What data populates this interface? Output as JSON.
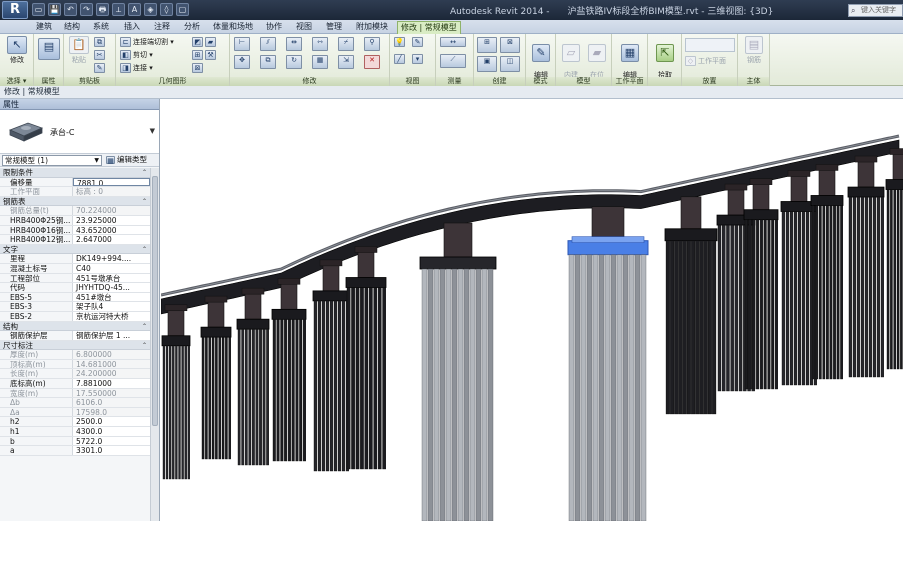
{
  "window": {
    "app_title": "Autodesk Revit 2014 -",
    "document_title": "沪盐铁路IV标段全桥BIM模型.rvt - 三维视图: {3D}",
    "search_placeholder": "键入关键字"
  },
  "app_button": {
    "label": "R"
  },
  "quick_access": [
    "open-icon",
    "save-icon",
    "undo-icon",
    "redo-icon",
    "print-icon",
    "measure-icon",
    "text-icon",
    "3d-view-icon",
    "section-icon",
    "close-hidden-icon"
  ],
  "quick_access_glyphs": [
    "▭",
    "💾",
    "↶",
    "↷",
    "🖶",
    "⟂",
    "A",
    "◈",
    "◊",
    "▢"
  ],
  "tabs": [
    {
      "label": "建筑"
    },
    {
      "label": "结构"
    },
    {
      "label": "系统"
    },
    {
      "label": "插入"
    },
    {
      "label": "注释"
    },
    {
      "label": "分析"
    },
    {
      "label": "体量和场地"
    },
    {
      "label": "协作"
    },
    {
      "label": "视图"
    },
    {
      "label": "管理"
    },
    {
      "label": "附加模块"
    },
    {
      "label": "修改 | 常规模型"
    }
  ],
  "ribbon": {
    "select": {
      "panel_label": "选择 ▾",
      "modify_label": "修改"
    },
    "properties": {
      "panel_label": "属性"
    },
    "clipboard": {
      "panel_label": "剪贴板",
      "paste_label": "粘贴"
    },
    "geometry": {
      "panel_label": "几何图形",
      "join_cut_label": "连接端切割 ▾",
      "cut_label": "剪切 ▾",
      "join_label": "连接 ▾"
    },
    "modify": {
      "panel_label": "修改"
    },
    "view": {
      "panel_label": "视图"
    },
    "measure": {
      "panel_label": "测量"
    },
    "create": {
      "panel_label": "创建"
    },
    "mode": {
      "panel_label": "模式",
      "edit_family_label": "编辑\n族"
    },
    "model": {
      "panel_label": "模型",
      "inplace_label": "内建\n模型",
      "massing_label": "在位\n体量"
    },
    "work_plane": {
      "panel_label": "工作平面",
      "edit_wp_label": "编辑\n工作平面",
      "pick_new_label": "拾取\n新的"
    },
    "place": {
      "panel_label": "放置",
      "wp_label": "工作平面"
    },
    "host": {
      "panel_label": "主体",
      "rebar_label": "钢筋"
    }
  },
  "options_bar": {
    "label": "修改 | 常规模型"
  },
  "properties": {
    "header": "属性",
    "type_name": "承台-C",
    "filter_label": "常规模型 (1)",
    "edit_type_label": "编辑类型",
    "groups": [
      {
        "name": "限制条件",
        "rows": [
          {
            "name": "偏移量",
            "value": "7881.0",
            "readonly": false,
            "selected": true
          },
          {
            "name": "工作平面",
            "value": "标高 : 0",
            "readonly": true
          }
        ]
      },
      {
        "name": "钢筋表",
        "rows": [
          {
            "name": "钢筋总量(t)",
            "value": "70.224000",
            "readonly": true
          },
          {
            "name": "HRB400Φ25钢...",
            "value": "23.925000",
            "readonly": false
          },
          {
            "name": "HRB400Φ16钢...",
            "value": "43.652000",
            "readonly": false
          },
          {
            "name": "HRB400Φ12钢...",
            "value": "2.647000",
            "readonly": false
          }
        ]
      },
      {
        "name": "文字",
        "rows": [
          {
            "name": "里程",
            "value": "DK149+994....",
            "readonly": false
          },
          {
            "name": "混凝土标号",
            "value": "C40",
            "readonly": false
          },
          {
            "name": "工程部位",
            "value": "451号墩承台",
            "readonly": false
          },
          {
            "name": "代码",
            "value": "JHYHTDQ-45...",
            "readonly": false
          },
          {
            "name": "EBS-5",
            "value": "451#墩台",
            "readonly": false
          },
          {
            "name": "EBS-3",
            "value": "架子队4",
            "readonly": false
          },
          {
            "name": "EBS-2",
            "value": "京杭运河特大桥",
            "readonly": false
          }
        ]
      },
      {
        "name": "结构",
        "rows": [
          {
            "name": "钢筋保护层",
            "value": "钢筋保护层 1 ...",
            "readonly": false
          }
        ]
      },
      {
        "name": "尺寸标注",
        "rows": [
          {
            "name": "厚度(m)",
            "value": "6.800000",
            "readonly": true
          },
          {
            "name": "顶标高(m)",
            "value": "14.681000",
            "readonly": true
          },
          {
            "name": "长度(m)",
            "value": "24.200000",
            "readonly": true
          },
          {
            "name": "底标高(m)",
            "value": "7.881000",
            "readonly": false
          },
          {
            "name": "宽度(m)",
            "value": "17.550000",
            "readonly": true
          },
          {
            "name": "Δb",
            "value": "6106.0",
            "readonly": true
          },
          {
            "name": "Δa",
            "value": "17598.0",
            "readonly": true
          },
          {
            "name": "h2",
            "value": "2500.0",
            "readonly": false
          },
          {
            "name": "h1",
            "value": "4300.0",
            "readonly": false
          },
          {
            "name": "b",
            "value": "5722.0",
            "readonly": false
          },
          {
            "name": "a",
            "value": "3301.0",
            "readonly": false
          }
        ]
      }
    ]
  },
  "viewport": {
    "view_name": "{3D}",
    "highlight_color": "#4a7fe6"
  }
}
